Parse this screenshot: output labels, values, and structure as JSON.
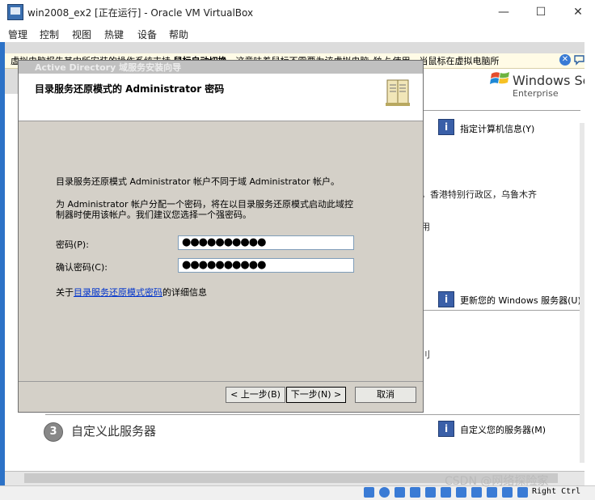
{
  "window": {
    "title": "win2008_ex2 [正在运行] - Oracle VM VirtualBox",
    "controls": {
      "minimize": "—",
      "maximize": "☐",
      "close": "✕"
    }
  },
  "menubar": [
    "管理",
    "控制",
    "视图",
    "热键",
    "设备",
    "帮助"
  ],
  "notification": {
    "text_before": "虚拟电脑报告其内所安装的操作系统支持 ",
    "text_bold": "鼠标自动切换",
    "text_after": "。这意味着鼠标不需要为该虚拟电脑 ",
    "text_italic": "独占",
    "text_end": " 使用，当鼠标在虚拟电脑所",
    "close_icon": "✕"
  },
  "guest": {
    "windows_logo": {
      "text": "Windows Ser",
      "edition": "Enterprise"
    },
    "tasks": [
      {
        "label": "指定计算机信息(Y)"
      },
      {
        "label": "更新您的 Windows 服务器(U)"
      },
      {
        "label": "自定义您的服务器(M)"
      }
    ],
    "background_texts": [
      "，香港特别行政区，乌鲁木齐",
      "用",
      "刂"
    ],
    "section3": {
      "number": "3",
      "title": "自定义此服务器"
    }
  },
  "dialog": {
    "title": "Active Directory 域服务安装向导",
    "heading": "目录服务还原模式的 Administrator 密码",
    "line1": "目录服务还原模式 Administrator 帐户不同于域 Administrator 帐户。",
    "line2": "为 Administrator 帐户分配一个密码，将在以目录服务还原模式启动此域控",
    "line3": "制器时使用该帐户。我们建议您选择一个强密码。",
    "password_label": "密码(P):",
    "password_value": "●●●●●●●●●●",
    "confirm_label": "确认密码(C):",
    "confirm_value": "●●●●●●●●●●",
    "more_prefix": "关于",
    "more_link": "目录服务还原模式密码",
    "more_suffix": "的详细信息",
    "buttons": {
      "back": "< 上一步(B)",
      "next": "下一步(N) >",
      "cancel": "取消"
    }
  },
  "statusbar": {
    "host_key": "Right Ctrl"
  },
  "watermark": "CSDN @网络探险家"
}
